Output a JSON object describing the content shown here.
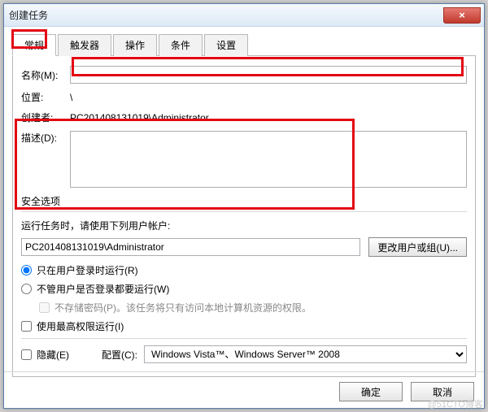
{
  "window": {
    "title": "创建任务",
    "close": "×"
  },
  "tabs": {
    "general": "常规",
    "triggers": "触发器",
    "actions": "操作",
    "conditions": "条件",
    "settings": "设置"
  },
  "fields": {
    "name_label": "名称(M):",
    "name_value": "",
    "location_label": "位置:",
    "location_value": "\\",
    "creator_label": "创建者:",
    "creator_value": "PC201408131019\\Administrator",
    "desc_label": "描述(D):",
    "desc_value": ""
  },
  "security": {
    "section": "安全选项",
    "run_as": "运行任务时，请使用下列用户帐户:",
    "account": "PC201408131019\\Administrator",
    "change_user": "更改用户或组(U)...",
    "radio1": "只在用户登录时运行(R)",
    "radio2": "不管用户是否登录都要运行(W)",
    "store_pw": "不存储密码(P)。该任务将只有访问本地计算机资源的权限。",
    "highest": "使用最高权限运行(I)"
  },
  "bottom": {
    "hidden": "隐藏(E)",
    "config_label": "配置(C):",
    "config_value": "Windows Vista™、Windows Server™ 2008"
  },
  "buttons": {
    "ok": "确定",
    "cancel": "取消"
  },
  "watermark": "@51CTO博客"
}
